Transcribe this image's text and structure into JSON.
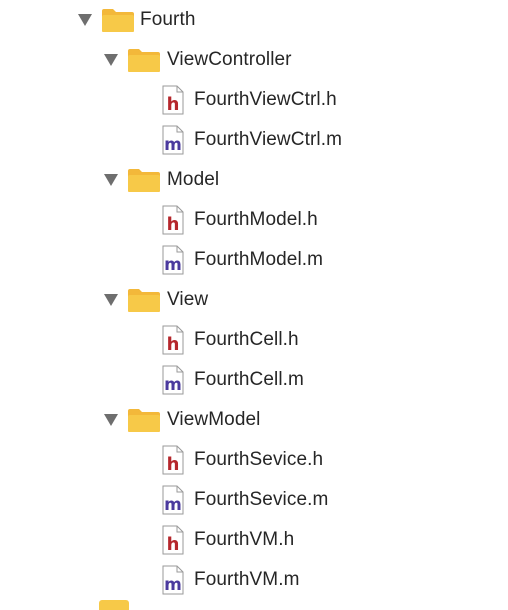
{
  "tree": {
    "root": {
      "label": "Fourth",
      "icon": "folder-icon",
      "groups": [
        {
          "label": "ViewController",
          "files": [
            {
              "name": "FourthViewCtrl.h",
              "type": "h"
            },
            {
              "name": "FourthViewCtrl.m",
              "type": "m"
            }
          ]
        },
        {
          "label": "Model",
          "files": [
            {
              "name": "FourthModel.h",
              "type": "h"
            },
            {
              "name": "FourthModel.m",
              "type": "m"
            }
          ]
        },
        {
          "label": "View",
          "files": [
            {
              "name": "FourthCell.h",
              "type": "h"
            },
            {
              "name": "FourthCell.m",
              "type": "m"
            }
          ]
        },
        {
          "label": "ViewModel",
          "files": [
            {
              "name": "FourthSevice.h",
              "type": "h"
            },
            {
              "name": "FourthSevice.m",
              "type": "m"
            },
            {
              "name": "FourthVM.h",
              "type": "h"
            },
            {
              "name": "FourthVM.m",
              "type": "m"
            }
          ]
        }
      ]
    }
  },
  "icons": {
    "header_letter": "h",
    "impl_letter": "m"
  },
  "colors": {
    "folder": "#f7c948",
    "folder_tab": "#f3b83a",
    "header_file_letter": "#b5262b",
    "impl_file_letter": "#4b3a9e",
    "disclosure": "#6e6e6e",
    "text": "#262626"
  }
}
